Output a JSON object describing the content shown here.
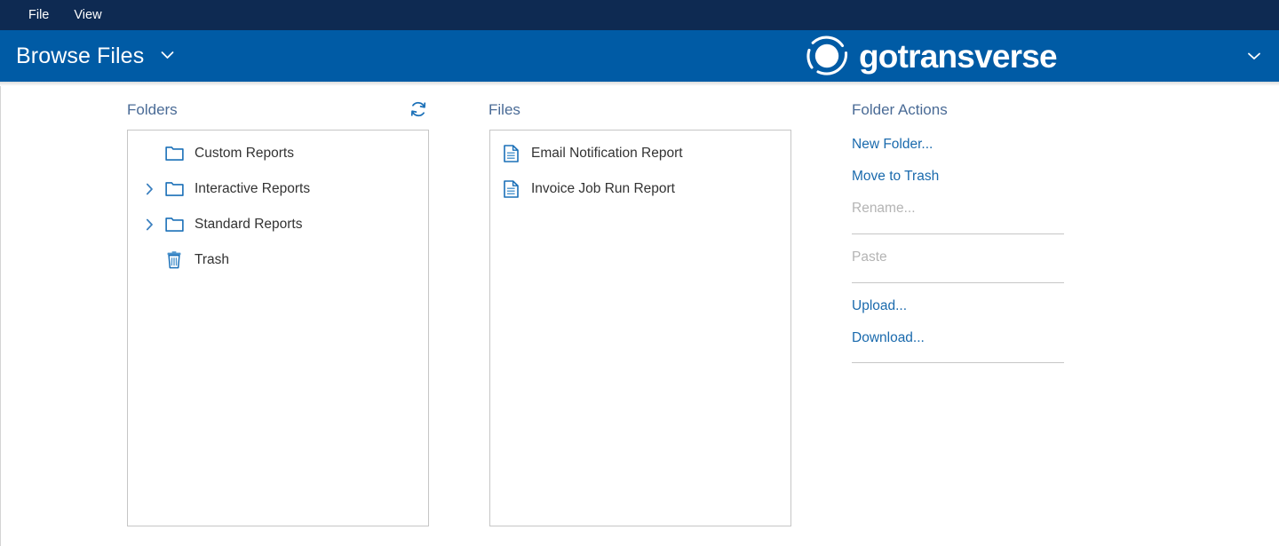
{
  "menubar": {
    "items": [
      {
        "label": "File"
      },
      {
        "label": "View"
      }
    ]
  },
  "appbar": {
    "title": "Browse Files",
    "title_caret_icon": "chevron-down-icon",
    "brand_name": "gotransverse",
    "brand_mark_icon": "gotransverse-logo-icon",
    "right_caret_icon": "chevron-down-icon",
    "background_color": "#005ba5",
    "menubar_color": "#0e2a52"
  },
  "folders_panel": {
    "heading": "Folders",
    "refresh_icon": "refresh-icon",
    "items": [
      {
        "label": "Custom Reports",
        "icon": "folder-icon",
        "expandable": false
      },
      {
        "label": "Interactive Reports",
        "icon": "folder-icon",
        "expandable": true
      },
      {
        "label": "Standard Reports",
        "icon": "folder-icon",
        "expandable": true
      },
      {
        "label": "Trash",
        "icon": "trash-icon",
        "expandable": false
      }
    ]
  },
  "files_panel": {
    "heading": "Files",
    "items": [
      {
        "label": "Email Notification Report",
        "icon": "document-icon"
      },
      {
        "label": "Invoice Job Run Report",
        "icon": "document-icon"
      }
    ]
  },
  "folder_actions": {
    "heading": "Folder Actions",
    "items": [
      {
        "label": "New Folder...",
        "enabled": true
      },
      {
        "label": "Move to Trash",
        "enabled": true
      },
      {
        "label": "Rename...",
        "enabled": false
      },
      {
        "label": "Paste",
        "enabled": false
      },
      {
        "label": "Upload...",
        "enabled": true
      },
      {
        "label": "Download...",
        "enabled": true
      }
    ]
  },
  "colors": {
    "link": "#1a6aad",
    "disabled": "#b4b4b4",
    "heading": "#4a6b96",
    "icon_blue": "#1b70b8",
    "panel_border": "#c6c6c6"
  }
}
